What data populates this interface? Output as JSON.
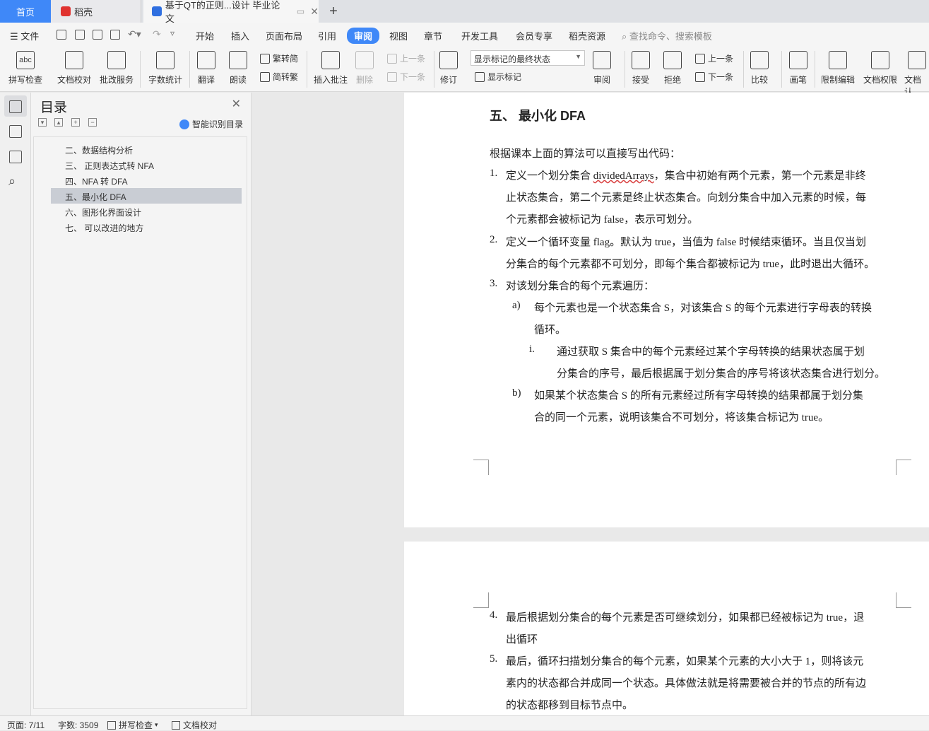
{
  "tabs": {
    "home": "首页",
    "daoke": "稻壳",
    "doc": "基于QT的正则...设计 毕业论文"
  },
  "menubar": {
    "file": "文件",
    "items": [
      "开始",
      "插入",
      "页面布局",
      "引用",
      "审阅",
      "视图",
      "章节",
      "开发工具",
      "会员专享",
      "稻壳资源"
    ],
    "search": "查找命令、搜索模板"
  },
  "ribbon": {
    "spell_check": "拼写检查",
    "doc_proof": "文档校对",
    "correction_service": "批改服务",
    "word_count": "字数统计",
    "translate": "翻译",
    "read_aloud": "朗读",
    "trad_to_simp": "繁转简",
    "simp_to_trad": "简转繁",
    "insert_comment": "插入批注",
    "delete": "删除",
    "prev": "上一条",
    "next": "下一条",
    "track_changes": "修订",
    "markup_select": "显示标记的最终状态",
    "show_markup": "显示标记",
    "review": "审阅",
    "accept": "接受",
    "reject": "拒绝",
    "prev2": "上一条",
    "next2": "下一条",
    "compare": "比较",
    "ink": "画笔",
    "restrict_edit": "限制编辑",
    "doc_permission": "文档权限",
    "doc_cert": "文档认"
  },
  "toc": {
    "title": "目录",
    "smart": "智能识别目录",
    "items": [
      "二、数据结构分析",
      "三、 正则表达式转 NFA",
      "四、NFA 转 DFA",
      "五、最小化 DFA",
      "六、图形化界面设计",
      "七、 可以改进的地方"
    ]
  },
  "document": {
    "heading": "五、 最小化 DFA",
    "intro": "根据课本上面的算法可以直接写出代码：",
    "p1": {
      "num": "1.",
      "l1a": "定义一个划分集合 ",
      "l1b": "dividedArrays",
      "l1c": "，集合中初始有两个元素，第一个元素是非终",
      "l2": "止状态集合，第二个元素是终止状态集合。向划分集合中加入元素的时候，每",
      "l3": "个元素都会被标记为 false，表示可划分。"
    },
    "p2": {
      "num": "2.",
      "l1": "定义一个循环变量 flag。默认为 true，当值为 false 时候结束循环。当且仅当划",
      "l2": "分集合的每个元素都不可划分，即每个集合都被标记为 true，此时退出大循环。"
    },
    "p3": {
      "num": "3.",
      "l1": "对该划分集合的每个元素遍历："
    },
    "pa": {
      "num": "a)",
      "l1": "每个元素也是一个状态集合 S，对该集合 S 的每个元素进行字母表的转换",
      "l2": "循环。"
    },
    "pi": {
      "num": "i.",
      "l1": "通过获取 S 集合中的每个元素经过某个字母转换的结果状态属于划",
      "l2": "分集合的序号，最后根据属于划分集合的序号将该状态集合进行划分。"
    },
    "pb": {
      "num": "b)",
      "l1": "如果某个状态集合 S 的所有元素经过所有字母转换的结果都属于划分集",
      "l2": "合的同一个元素，说明该集合不可划分，将该集合标记为 true。"
    },
    "p4": {
      "num": "4.",
      "l1": "最后根据划分集合的每个元素是否可继续划分，如果都已经被标记为 true，退",
      "l2": "出循环"
    },
    "p5": {
      "num": "5.",
      "l1": "最后，循环扫描划分集合的每个元素，如果某个元素的大小大于 1，则将该元",
      "l2": "素内的状态都合并成同一个状态。具体做法就是将需要被合并的节点的所有边",
      "l3": "的状态都移到目标节点中。"
    }
  },
  "status": {
    "page": "页面: 7/11",
    "words": "字数: 3509",
    "spell": "拼写检查",
    "proof": "文档校对"
  },
  "colors": {
    "accent": "#3f88f8",
    "selection": "#c9cdd4"
  }
}
